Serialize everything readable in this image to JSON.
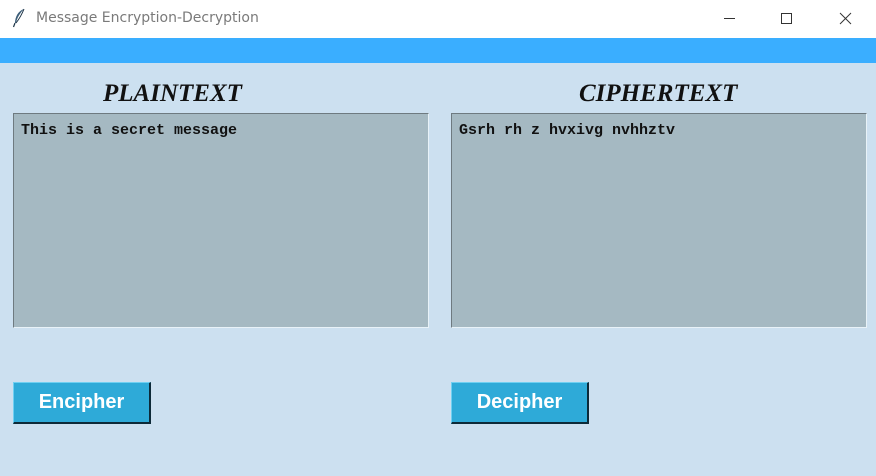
{
  "window": {
    "title": "Message Encryption-Decryption",
    "icon": "feather-icon",
    "controls": [
      "minimize-icon",
      "maximize-icon",
      "close-icon"
    ]
  },
  "colors": {
    "accent_bar": "#3aaeff",
    "background": "#cce0f0",
    "textbox": "#a5b9c2",
    "button": "#2eaad8"
  },
  "plaintext": {
    "heading": "PLAINTEXT",
    "value": "This is a secret message"
  },
  "ciphertext": {
    "heading": "CIPHERTEXT",
    "value": "Gsrh rh z hvxivg nvhhztv"
  },
  "buttons": {
    "encipher_label": "Encipher",
    "decipher_label": "Decipher"
  }
}
